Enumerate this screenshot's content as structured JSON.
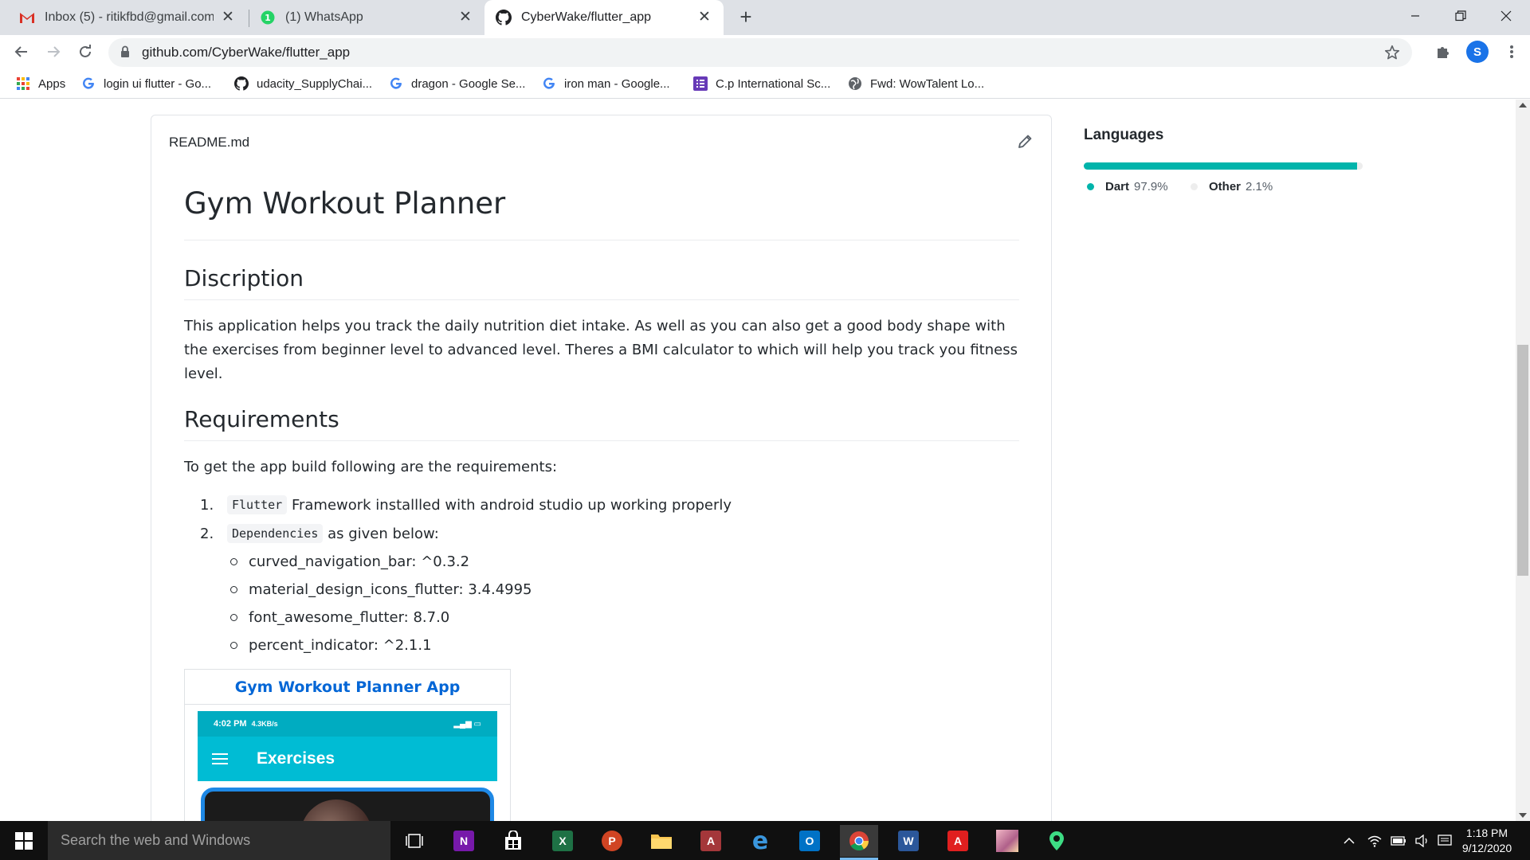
{
  "browser": {
    "tabs": [
      {
        "title": "Inbox (5) - ritikfbd@gmail.com - ",
        "icon": "gmail-icon",
        "close": "✕",
        "active": false
      },
      {
        "title": "(1) WhatsApp",
        "icon": "whatsapp-icon",
        "close": "✕",
        "active": false
      },
      {
        "title": "CyberWake/flutter_app",
        "icon": "github-icon",
        "close": "✕",
        "active": true
      }
    ],
    "new_tab": "+",
    "url": "github.com/CyberWake/flutter_app",
    "profile_initial": "S",
    "bookmarks": [
      {
        "label": "Apps",
        "icon": "apps-grid-icon"
      },
      {
        "label": "login ui flutter - Go...",
        "icon": "google-icon"
      },
      {
        "label": "udacity_SupplyChai...",
        "icon": "github-icon"
      },
      {
        "label": "dragon - Google Se...",
        "icon": "google-icon"
      },
      {
        "label": "iron man - Google...",
        "icon": "google-icon"
      },
      {
        "label": "C.p International Sc...",
        "icon": "form-icon"
      },
      {
        "label": "Fwd: WowTalent Lo...",
        "icon": "globe-icon"
      }
    ]
  },
  "readme": {
    "filename": "README.md",
    "title": "Gym Workout Planner",
    "description_heading": "Discription",
    "description_text": "This application helps you track the daily nutrition diet intake. As well as you can also get a good body shape with the exercises from beginner level to advanced level. Theres a BMI calculator to which will help you track you fitness level.",
    "requirements_heading": "Requirements",
    "requirements_intro": "To get the app build following are the requirements:",
    "requirements": [
      {
        "num": "1.",
        "code": "Flutter",
        "text": " Framework installled with android studio up working properly"
      },
      {
        "num": "2.",
        "code": "Dependencies",
        "text": " as given below:"
      }
    ],
    "dependencies": [
      "curved_navigation_bar: ^0.3.2",
      "material_design_icons_flutter: 3.4.4995",
      "font_awesome_flutter: 8.7.0",
      "percent_indicator: ^2.1.1"
    ],
    "table_header": "Gym Workout Planner App",
    "phone": {
      "status_time": "4:02 PM",
      "status_speed": "4.3KB/s",
      "appbar_title": "Exercises"
    }
  },
  "sidebar": {
    "languages_title": "Languages",
    "languages": [
      {
        "name": "Dart",
        "percent_label": "97.9%",
        "percent": 97.9,
        "color": "#00B4AB"
      },
      {
        "name": "Other",
        "percent_label": "2.1%",
        "percent": 2.1,
        "color": "#ededed"
      }
    ]
  },
  "taskbar": {
    "search_placeholder": "Search the web and Windows",
    "apps": [
      "task-view-icon",
      "onenote-icon",
      "store-icon",
      "excel-icon",
      "powerpoint-icon",
      "file-explorer-icon",
      "access-icon",
      "edge-icon",
      "outlook-icon",
      "chrome-icon",
      "word-icon",
      "acrobat-icon",
      "photos-icon",
      "maps-icon"
    ],
    "time": "1:18 PM",
    "date": "9/12/2020"
  },
  "colors": {
    "link": "#0366d6",
    "dart": "#00B4AB",
    "chrome_blue": "#1a73e8"
  }
}
